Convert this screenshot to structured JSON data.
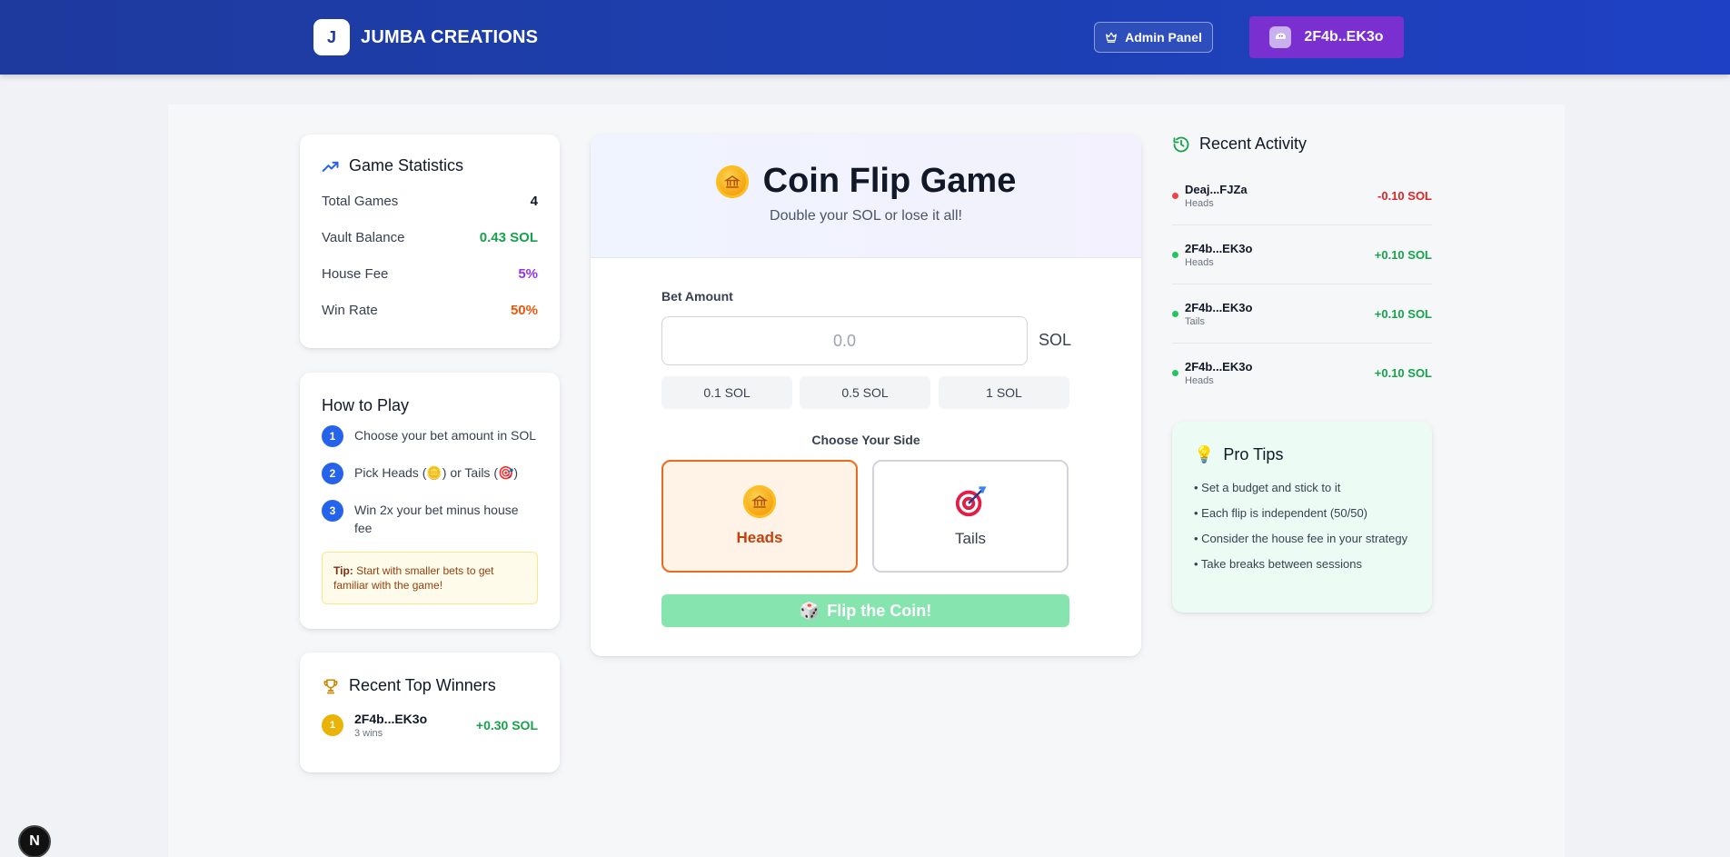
{
  "header": {
    "logo_letter": "J",
    "brand_name": "JUMBA CREATIONS",
    "admin_label": "Admin Panel",
    "wallet_label": "2F4b..EK3o"
  },
  "stats": {
    "title": "Game Statistics",
    "rows": [
      {
        "label": "Total Games",
        "value": "4",
        "color": "#111827"
      },
      {
        "label": "Vault Balance",
        "value": "0.43 SOL",
        "color": "#16a34a"
      },
      {
        "label": "House Fee",
        "value": "5%",
        "color": "#9333ea"
      },
      {
        "label": "Win Rate",
        "value": "50%",
        "color": "#ea580c"
      }
    ]
  },
  "how_to_play": {
    "title": "How to Play",
    "steps": [
      {
        "num": "1",
        "text": "Choose your bet amount in SOL"
      },
      {
        "num": "2",
        "text": "Pick Heads (🪙) or Tails (🎯)"
      },
      {
        "num": "3",
        "text": "Win 2x your bet minus house fee"
      }
    ],
    "tip_label": "Tip:",
    "tip_text": " Start with smaller bets to get familiar with the game!"
  },
  "top_winners": {
    "title": "Recent Top Winners",
    "items": [
      {
        "rank": "1",
        "name": "2F4b...EK3o",
        "wins": "3 wins",
        "amount": "+0.30 SOL"
      }
    ]
  },
  "game": {
    "title": "Coin Flip Game",
    "subtitle": "Double your SOL or lose it all!",
    "bet_label": "Bet Amount",
    "bet_placeholder": "0.0",
    "bet_unit": "SOL",
    "quick_bets": [
      "0.1 SOL",
      "0.5 SOL",
      "1 SOL"
    ],
    "choose_label": "Choose Your Side",
    "heads_label": "Heads",
    "tails_label": "Tails",
    "flip_label": "Flip the Coin!",
    "flip_icon": "🎲",
    "selected_side": "Heads"
  },
  "activity": {
    "title": "Recent Activity",
    "items": [
      {
        "name": "Deaj...FJZa",
        "side": "Heads",
        "amount": "-0.10 SOL",
        "color": "#dc2626",
        "dot": "#ef4444"
      },
      {
        "name": "2F4b...EK3o",
        "side": "Heads",
        "amount": "+0.10 SOL",
        "color": "#16a34a",
        "dot": "#22c55e"
      },
      {
        "name": "2F4b...EK3o",
        "side": "Tails",
        "amount": "+0.10 SOL",
        "color": "#16a34a",
        "dot": "#22c55e"
      },
      {
        "name": "2F4b...EK3o",
        "side": "Heads",
        "amount": "+0.10 SOL",
        "color": "#16a34a",
        "dot": "#22c55e"
      }
    ]
  },
  "pro_tips": {
    "icon": "💡",
    "title": "Pro Tips",
    "items": [
      "• Set a budget and stick to it",
      "• Each flip is independent (50/50)",
      "• Consider the house fee in your strategy",
      "• Take breaks between sessions"
    ]
  },
  "dev_badge": "N"
}
